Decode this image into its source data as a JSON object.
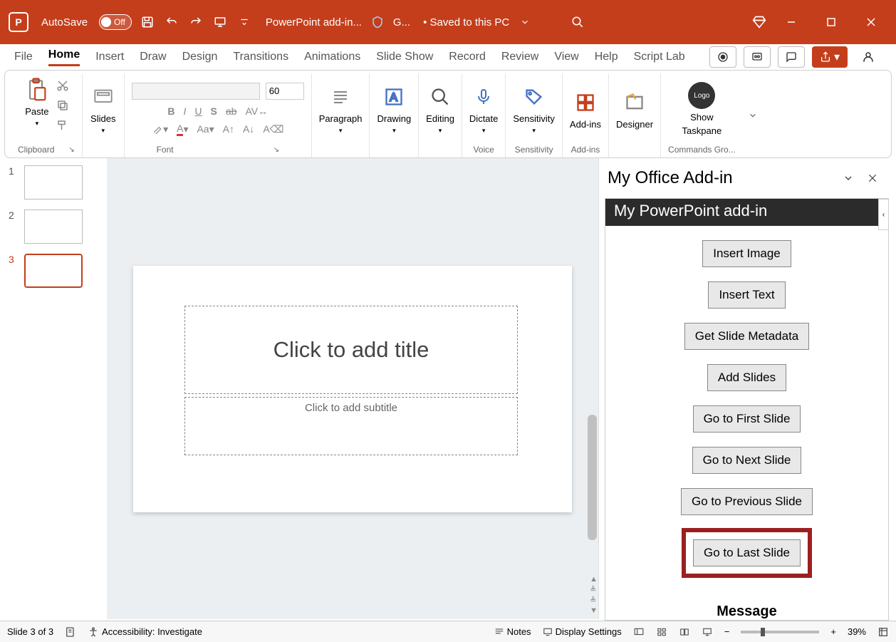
{
  "titlebar": {
    "autosave_label": "AutoSave",
    "autosave_state": "Off",
    "doc_title": "PowerPoint add-in...",
    "sensitivity_text": "G...",
    "saved_text": "• Saved to this PC"
  },
  "tabs": [
    "File",
    "Home",
    "Insert",
    "Draw",
    "Design",
    "Transitions",
    "Animations",
    "Slide Show",
    "Record",
    "Review",
    "View",
    "Help",
    "Script Lab"
  ],
  "active_tab": "Home",
  "ribbon": {
    "clipboard": {
      "paste": "Paste",
      "label": "Clipboard"
    },
    "slides": {
      "slides": "Slides"
    },
    "font": {
      "size": "60",
      "label": "Font"
    },
    "paragraph": "Paragraph",
    "drawing": "Drawing",
    "editing": "Editing",
    "dictate": "Dictate",
    "voice": "Voice",
    "sensitivity": "Sensitivity",
    "sensitivity_label": "Sensitivity",
    "addins": "Add-ins",
    "addins_label": "Add-ins",
    "designer": "Designer",
    "show_taskpane_l1": "Show",
    "show_taskpane_l2": "Taskpane",
    "commands_label": "Commands Gro..."
  },
  "thumbs": [
    {
      "num": "1",
      "selected": false
    },
    {
      "num": "2",
      "selected": false
    },
    {
      "num": "3",
      "selected": true
    }
  ],
  "slide": {
    "title_placeholder": "Click to add title",
    "subtitle_placeholder": "Click to add subtitle"
  },
  "pane": {
    "header": "My Office Add-in",
    "title": "My PowerPoint add-in",
    "buttons": [
      "Insert Image",
      "Insert Text",
      "Get Slide Metadata",
      "Add Slides",
      "Go to First Slide",
      "Go to Next Slide",
      "Go to Previous Slide",
      "Go to Last Slide"
    ],
    "highlighted_index": 7,
    "message": "Message"
  },
  "status": {
    "slide": "Slide 3 of 3",
    "accessibility": "Accessibility: Investigate",
    "notes": "Notes",
    "display_settings": "Display Settings",
    "zoom": "39%"
  }
}
